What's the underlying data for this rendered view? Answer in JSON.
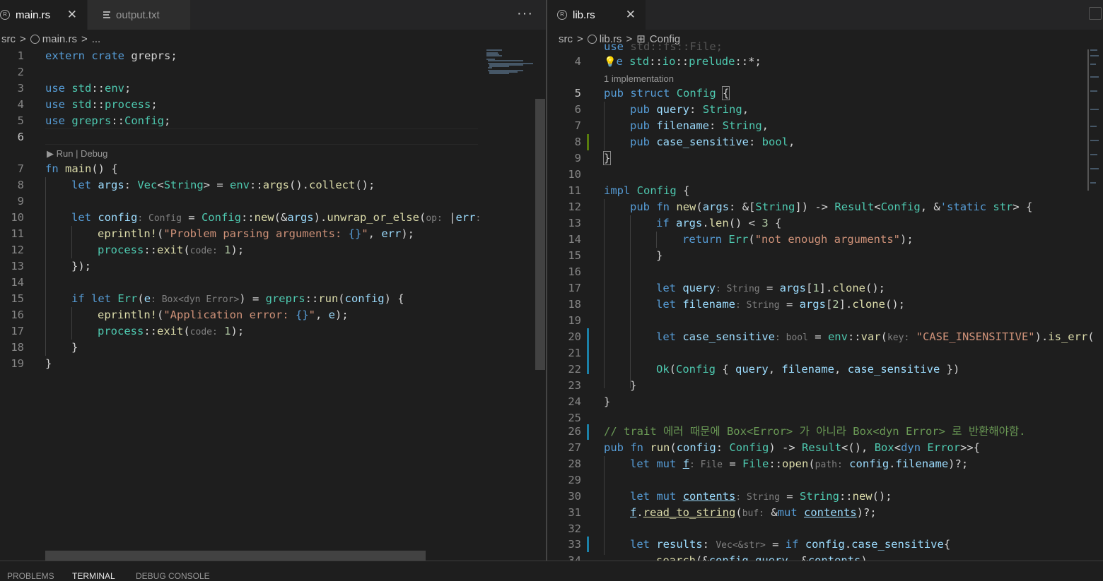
{
  "left": {
    "tabs": [
      {
        "label": "main.rs",
        "active": true,
        "icon": "rust-icon"
      },
      {
        "label": "output.txt",
        "active": false,
        "icon": "text-file-icon"
      }
    ],
    "breadcrumb": [
      "src",
      ">",
      "main.rs",
      ">",
      "..."
    ],
    "lens_run": "▶ Run | Debug",
    "line_numbers": [
      "1",
      "2",
      "3",
      "4",
      "5",
      "6",
      "7",
      "8",
      "9",
      "10",
      "11",
      "12",
      "13",
      "14",
      "15",
      "16",
      "17",
      "18",
      "19"
    ]
  },
  "right": {
    "tabs": [
      {
        "label": "lib.rs",
        "active": true,
        "icon": "rust-icon"
      }
    ],
    "breadcrumb": [
      "src",
      ">",
      "lib.rs",
      ">",
      "Config"
    ],
    "lens_impl": "1 implementation",
    "line_numbers": [
      "4",
      "5",
      "6",
      "7",
      "8",
      "9",
      "10",
      "11",
      "12",
      "13",
      "14",
      "15",
      "16",
      "17",
      "18",
      "19",
      "20",
      "21",
      "22",
      "23",
      "24",
      "25",
      "26",
      "27",
      "28",
      "29",
      "30",
      "31",
      "32",
      "33",
      "34"
    ]
  },
  "bottom_panel": {
    "tabs": [
      "PROBLEMS",
      "TERMINAL",
      "DEBUG CONSOLE"
    ],
    "active": "TERMINAL"
  },
  "colors": {
    "keyword": "#569cd6",
    "type": "#4ec9b0",
    "function": "#dcdcaa",
    "variable": "#9cdcfe",
    "string": "#ce9178",
    "number": "#b5cea8",
    "comment": "#6a9955"
  }
}
